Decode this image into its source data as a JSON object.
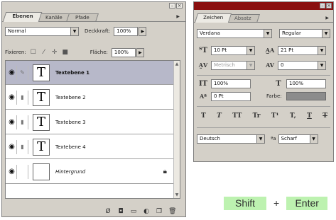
{
  "layers_panel": {
    "tabs": [
      "Ebenen",
      "Kanäle",
      "Pfade"
    ],
    "blend_mode": "Normal",
    "opacity_label": "Deckkraft:",
    "opacity_value": "100%",
    "lock_label": "Fixieren:",
    "fill_label": "Fläche:",
    "fill_value": "100%",
    "layers": [
      {
        "name": "Textebene 1",
        "thumb": "T",
        "selected": true
      },
      {
        "name": "Textebene 2",
        "thumb": "T",
        "selected": false
      },
      {
        "name": "Textebene 3",
        "thumb": "T",
        "selected": false
      },
      {
        "name": "Textebene 4",
        "thumb": "T",
        "selected": false
      },
      {
        "name": "Hintergrund",
        "thumb": "",
        "selected": false
      }
    ],
    "bottom_icons": [
      "link-layers-icon",
      "layer-style-icon",
      "mask-icon",
      "adjustment-icon",
      "new-layer-icon",
      "trash-icon"
    ]
  },
  "character_panel": {
    "tabs": [
      "Zeichen",
      "Absatz"
    ],
    "font_family": "Verdana",
    "font_style": "Regular",
    "font_size": "10 Pt",
    "leading": "21 Pt",
    "kerning": "Metrisch",
    "tracking": "0",
    "vertical_scale": "100%",
    "horizontal_scale": "100%",
    "baseline_shift": "0 Pt",
    "color_label": "Farbe:",
    "color_value": "#8c8c8c",
    "type_styles": [
      "T",
      "T",
      "TT",
      "Tr",
      "T¹",
      "T,",
      "T",
      "T"
    ],
    "language": "Deutsch",
    "antialias_glyph": "ªa",
    "antialias": "Scharf"
  },
  "shortcut": {
    "key1": "Shift",
    "plus": "+",
    "key2": "Enter"
  },
  "colors": {
    "panel_bg": "#d4d0c8",
    "selected_row": "#b7b8c9",
    "title_bar": "#8a1010",
    "key_bg": "#bdf2b0"
  }
}
